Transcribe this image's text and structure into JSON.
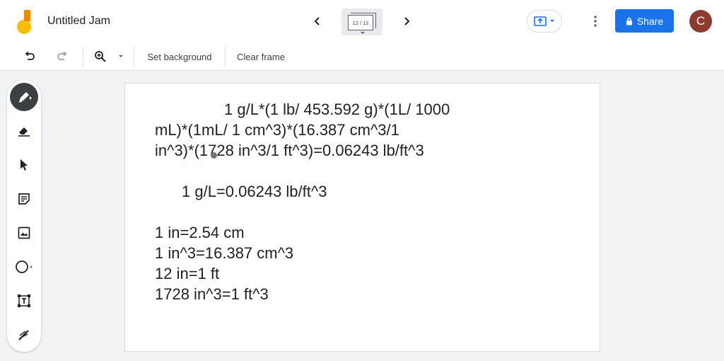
{
  "app": {
    "title": "Untitled Jam",
    "frame_indicator": "12 / 12",
    "share_label": "Share",
    "avatar_initial": "C",
    "accent_color": "#1a73e8"
  },
  "toolbar": {
    "set_background": "Set background",
    "clear_frame": "Clear frame"
  },
  "sidebar": {
    "tools": [
      "pen-tool",
      "eraser-tool",
      "select-tool",
      "sticky-note-tool",
      "image-tool",
      "shape-tool",
      "text-box-tool",
      "laser-tool"
    ],
    "active_tool": "pen-tool"
  },
  "canvas": {
    "lines": [
      "1 g/L*(1 lb/ 453.592 g)*(1L/ 1000",
      "mL)*(1mL/ 1 cm^3)*(16.387 cm^3/1",
      "in^3)*(1728 in^3/1 ft^3)=0.06243 lb/ft^3",
      "1 g/L=0.06243 lb/ft^3",
      "1 in=2.54 cm",
      "1 in^3=16.387 cm^3",
      "12 in=1 ft",
      "1728 in^3=1 ft^3"
    ]
  }
}
